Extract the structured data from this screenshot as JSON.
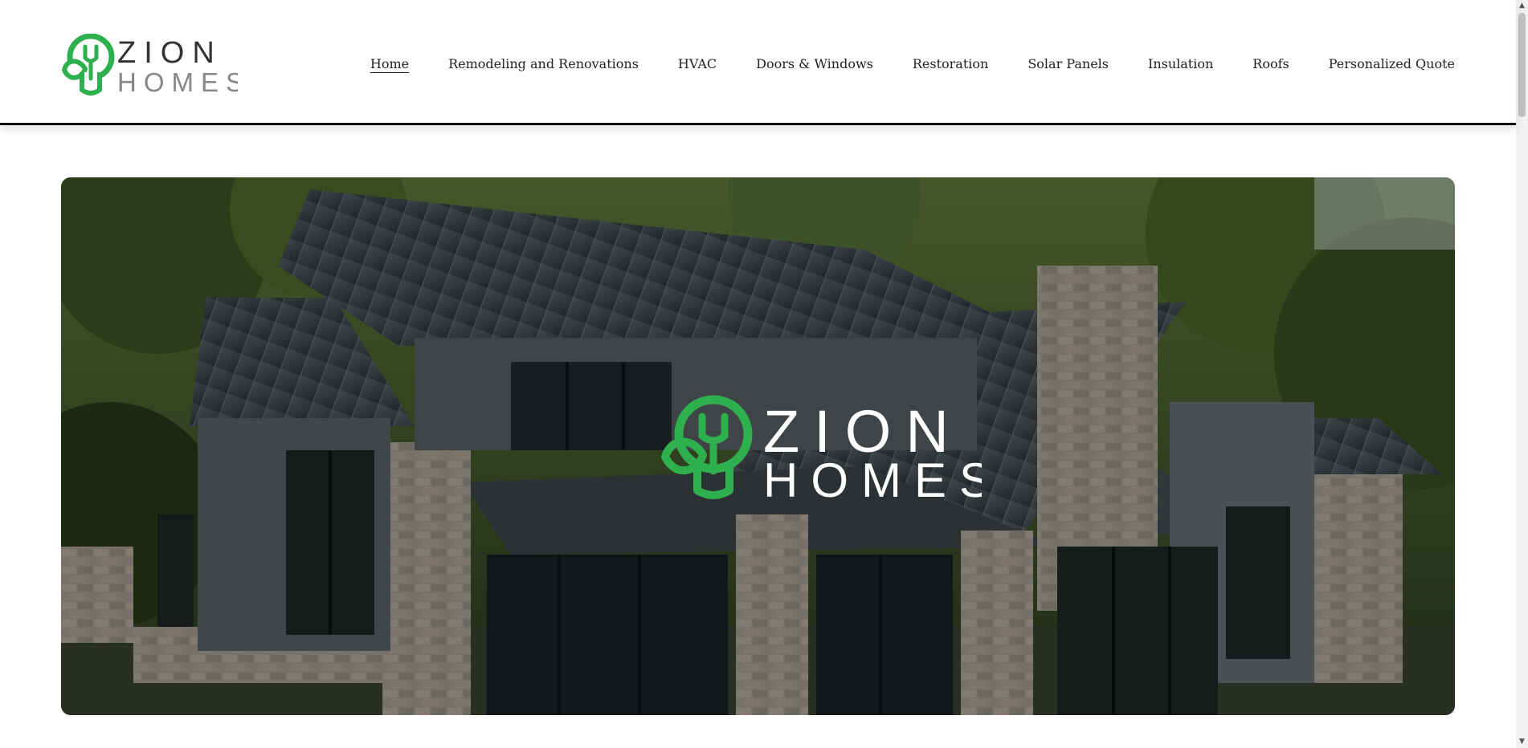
{
  "brand": {
    "logo_word1": "ZION",
    "logo_word2": "HOMES",
    "logo_icon": "lightbulb-leaf-icon",
    "accent_color": "#2fb04f"
  },
  "nav": {
    "items": [
      {
        "label": "Home",
        "active": true
      },
      {
        "label": "Remodeling and Renovations"
      },
      {
        "label": "HVAC"
      },
      {
        "label": "Doors & Windows"
      },
      {
        "label": "Restoration"
      },
      {
        "label": "Solar Panels"
      },
      {
        "label": "Insulation"
      },
      {
        "label": "Roofs"
      },
      {
        "label": "Personalized Quote"
      }
    ]
  },
  "hero": {
    "image": "modern-house-metal-roof-photo",
    "overlay_logo_word1": "ZION",
    "overlay_logo_word2": "HOMES"
  },
  "scrollbar": {
    "up_icon": "scroll-up-arrow-icon",
    "down_icon": "scroll-down-arrow-icon"
  }
}
